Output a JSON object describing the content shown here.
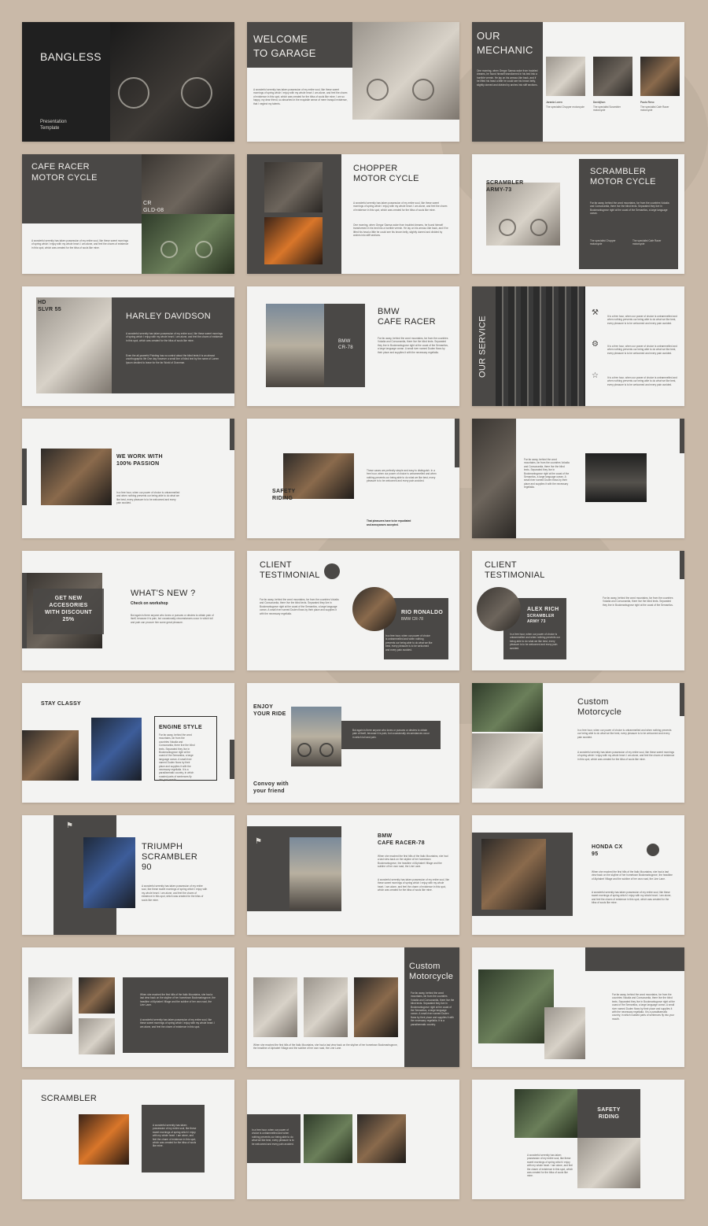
{
  "s1": {
    "title": "BANGLESS",
    "subtitle1": "Presentation",
    "subtitle2": "Template"
  },
  "s2": {
    "title1": "WELCOME",
    "title2": "TO GARAGE",
    "text": "A wonderful serenity has taken possession of my entire soul, like these sweet mornings of spring which I enjoy with my whole heart. I am alone, and feel the charm of existence in this spot, which was created for the bliss of souls like mine. I am so happy, my dear friend, so absorbed in the exquisite sense of mere tranquil existence, that I neglect my talents."
  },
  "s3": {
    "title1": "OUR",
    "title2": "MECHANIC",
    "text": "One morning, when Gregor Samsa woke from troubled dreams, he found himself transformed in his bed into a horrible vermin. He lay on his armour-like back, and if he lifted his head a little he could see his brown belly, slightly domed and divided by arches into stiff sections.",
    "people": [
      {
        "name": "Jaranla Loren",
        "role": "The specialist Chopper motorcycle"
      },
      {
        "name": "Davidjhon",
        "role": "The specialist Scrambler motorcycle"
      },
      {
        "name": "Paulo Reno",
        "role": "The specialist Cafe Racer motorcycle"
      }
    ]
  },
  "s4": {
    "title1": "CAFE RACER",
    "title2": "MOTOR CYCLE",
    "code1": "CR",
    "code2": "GLD-08",
    "text": "A wonderful serenity has taken possession of my entire soul, like these sweet mornings of spring which I enjoy with my whole heart. I am alone, and feel the charm of existence in this spot, which was created for the bliss of souls like mine."
  },
  "s5": {
    "title1": "CHOPPER",
    "title2": "MOTOR CYCLE",
    "text": "A wonderful serenity has taken possession of my entire soul, like these sweet mornings of spring which I enjoy with my whole heart. I am alone, and feel the charm of existence in this spot, which was created for the bliss of souls like mine.",
    "text2": "One morning, when Gregor Samsa woke from troubled dreams, he found himself transformed in his bed into a horrible vermin. He lay on his armour-like back, and if he lifted his head a little he could see his brown belly, slightly domed and divided by arches into stiff sections."
  },
  "s6": {
    "label1": "SCRAMBLER",
    "label2": "ARMY-73",
    "title1": "SCRAMBLER",
    "title2": "MOTOR CYCLE",
    "text": "Far far away, behind the word mountains, far from the countries Vokalia and Consonantia, there live the blind texts. Separated they live in Bookmarksgrove right at the coast of the Semantics, a large language ocean.",
    "caption1": "The specialist Chopper motorcycle",
    "caption2": "The specialist Cafe Racer motorcycle"
  },
  "s7": {
    "label1": "HD",
    "label2": "SLVR 55",
    "title": "HARLEY DAVIDSON",
    "text": "A wonderful serenity has taken possession of my entire soul, like these sweet mornings of spring which I enjoy with my whole heart. I am alone, and feel the charm of existence in this spot, which was created for the bliss of souls like mine.",
    "text2": "Even the all-powerful Pointing has no control about the blind texts it is an almost unorthographic life One day however a small line of blind text by the name of Lorem Ipsum decided to leave for the far World of Grammar."
  },
  "s8": {
    "title1": "BMW",
    "title2": "CAFE RACER",
    "label1": "BMW",
    "label2": "CR-78",
    "text": "Far far away, behind the word mountains, far from the countries Vokalia and Consonantia, there live the blind texts. Separated they live in Bookmarksgrove right at the coast of the Semantics, a large language ocean. A small river named Duden flows by their place and supplies it with the necessary regelialia."
  },
  "s9": {
    "title": "OUR SERVICE",
    "items": [
      "It is a free hour, when our power of choice is untrammelled and when nothing prevents our being able to do what we like best, every pleasure is to be welcomed and every pain avoided.",
      "It is a free hour, when our power of choice is untrammelled and when nothing prevents our being able to do what we like best, every pleasure is to be welcomed and every pain avoided.",
      "It is a free hour, when our power of choice is untrammelled and when nothing prevents our being able to do what we like best, every pleasure is to be welcomed and every pain avoided."
    ]
  },
  "s10": {
    "title1": "WE WORK WITH",
    "title2": "100% PASSION",
    "text": "In a free hour, when our power of choice is untrammelled and when nothing prevents our being able to do what we like best, every pleasure is to be welcomed and every pain avoided."
  },
  "s11": {
    "label1": "SAFETY",
    "label2": "RIDING",
    "text": "These cases are perfectly simple and easy to distinguish. In a free hour, when our power of choice is untrammelled and when nothing prevents our being able to do what we like best, every pleasure is to be welcomed and every pain avoided.",
    "bold1": "That pleasures have to be repudiated",
    "bold2": "and annoyances accepted."
  },
  "s12": {
    "text": "Far far away, behind the word mountains, far from the countries Vokalia and Consonantia, there live the blind texts. Separated they live in Bookmarksgrove right at the coast of the Semantics, a large language ocean. A small river named Duden flows by their place and supplies it with the necessary regelialia."
  },
  "s13": {
    "box1": "GET NEW",
    "box2": "ACCESORIES",
    "box3": "WITH DISCOUNT",
    "box4": "25%",
    "title": "WHAT'S NEW ?",
    "sub": "Check on workshop",
    "text": "But again is there anyone who loves or pursues or desires to obtain pain of itself, because it is pain, but occasionally circumstances occur in which toil and pain can procure him some great pleasure."
  },
  "s14": {
    "title1": "CLIENT",
    "title2": "TESTIMONIAL",
    "name1": "RIO RONALDO",
    "name2": "BMW CR-78",
    "text": "Far far away, behind the word mountains, far from the countries Vokalia and Consonantia, there live the blind texts. Separated they live in Bookmarksgrove right at the coast of the Semantics, a large language ocean. A small river named Duden flows by their place and supplies it with the necessary regelialia.",
    "text2": "In a free hour, when our power of choice is untrammelled and when nothing prevents our being able to do what we like best, every pleasure is to be welcomed and every pain avoided."
  },
  "s15": {
    "title1": "CLIENT",
    "title2": "TESTIMONIAL",
    "name1": "ALEX RICH",
    "name2": "SCRAMBLER",
    "name3": "ARMY 73",
    "text": "In a free hour, when our power of choice is untrammelled and when nothing prevents our being able to do what we like best, every pleasure is to be welcomed and every pain avoided.",
    "text2": "Far far away, behind the word mountains, far from the countries Vokalia and Consonantia, there live the blind texts. Separated they live in Bookmarksgrove right at the coast of the Semantics."
  },
  "s16": {
    "title": "STAY CLASSY",
    "box_title": "ENGINE STYLE",
    "text": "Far far away, behind the word mountains, far from the countries Vokalia and Consonantia, there live the blind texts. Separated they live in Bookmarksgrove right at the coast of the Semantics, a large language ocean. A small river named Duden flows by their place and supplies it with the necessary regelialia. It is a paradisematic country, in which roasted parts of sentences fly into your mouth."
  },
  "s17": {
    "title1": "ENJOY",
    "title2": "YOUR RIDE",
    "bottom1": "Convoy with",
    "bottom2": "your friend",
    "text": "But again is there anyone who loves or pursues or desires to obtain pain of itself, because it is pain, but occasionally circumstances occur in which toil and pain."
  },
  "s18": {
    "title1": "Custom",
    "title2": "Motorcycle",
    "text": "In a free hour, when our power of choice is untrammelled and when nothing prevents our being able to do what we like best, every pleasure is to be welcomed and every pain avoided.",
    "text2": "A wonderful serenity has taken possession of my entire soul, like these sweet mornings of spring which I enjoy with my whole heart. I am alone, and feel the charm of existence in this spot, which was created for the bliss of souls like mine."
  },
  "s19": {
    "title1": "TRIUMPH",
    "title2": "SCRAMBLER",
    "title3": "90",
    "text": "A wonderful serenity has taken possession of my entire soul, like these sweet mornings of spring which I enjoy with my whole heart. I am alone, and feel the charm of existence in this spot, which was created for the bliss of souls like mine."
  },
  "s20": {
    "title1": "BMW",
    "title2": "CAFE RACER-78",
    "text": "When she reached the first hills of the Italic Mountains, she had a last view back on the skyline of her hometown Bookmarksgrove, the headline of Alphabet Village and the subline of her own road, the Line Lane.",
    "text2": "A wonderful serenity has taken possession of my entire soul, like these sweet mornings of spring which I enjoy with my whole heart. I am alone, and feel the charm of existence in this spot, which was created for the bliss of souls like mine."
  },
  "s21": {
    "title1": "HONDA CX",
    "title2": "95",
    "text": "When she reached the first hills of the Italic Mountains, she had a last view back on the skyline of her hometown Bookmarksgrove, the headline of Alphabet Village and the subline of her own road, the Line Lane.",
    "text2": "A wonderful serenity has taken possession of my entire soul, like these sweet mornings of spring which I enjoy with my whole heart. I am alone, and feel the charm of existence in this spot, which was created for the bliss of souls like mine."
  },
  "s22": {
    "text": "When she reached the first hills of the Italic Mountains, she had a last view back on the skyline of her hometown Bookmarksgrove, the headline of Alphabet Village and the subline of her own road, the Line Lane.",
    "text2": "A wonderful serenity has taken possession of my entire soul, like these sweet mornings of spring which I enjoy with my whole heart. I am alone, and feel the charm of existence in this spot."
  },
  "s23": {
    "title1": "Custom",
    "title2": "Motorcycle",
    "text": "Far far away, behind the word mountains, far from the countries Vokalia and Consonantia, there live the blind texts. Separated they live in Bookmarksgrove right at the coast of the Semantics, a large language ocean. A small river named Duden flows by their place and supplies it with the necessary regelialia. It is a paradisematic country.",
    "caption": "When she reached the first hills of the Italic Mountains, she had a last view back on the skyline of her hometown Bookmarksgrove, the headline of Alphabet Village and the subline of her own road, the Line Lane."
  },
  "s24": {
    "text": "Far far away, behind the word mountains, far from the countries Vokalia and Consonantia, there live the blind texts. Separated they live in Bookmarksgrove right at the coast of the Semantics, a large language ocean. A small river named Duden flows by their place and supplies it with the necessary regelialia. It is a paradisematic country, in which roasted parts of sentences fly into your mouth."
  },
  "s25": {
    "title": "SCRAMBLER",
    "text": "A wonderful serenity has taken possession of my entire soul, like these sweet mornings of spring which I enjoy with my whole heart. I am alone, and feel the charm of existence in this spot, which was created for the bliss of souls like mine."
  },
  "s26": {
    "text": "In a free hour, when our power of choice is untrammelled and when nothing prevents our being able to do what we like best, every pleasure is to be welcomed and every pain avoided."
  },
  "s27": {
    "label1": "SAFETY",
    "label2": "RIDING",
    "text": "A wonderful serenity has taken possession of my entire soul, like these sweet mornings of spring which I enjoy with my whole heart. I am alone, and feel the charm of existence in this spot, which was created for the bliss of souls like mine."
  },
  "icons": [
    "wrench-icon",
    "gear-icon",
    "star-icon",
    "bookmark-icon"
  ],
  "colors": {
    "background": "#c9b9a8",
    "slide": "#f3f3f2",
    "panel": "#4a4846"
  }
}
